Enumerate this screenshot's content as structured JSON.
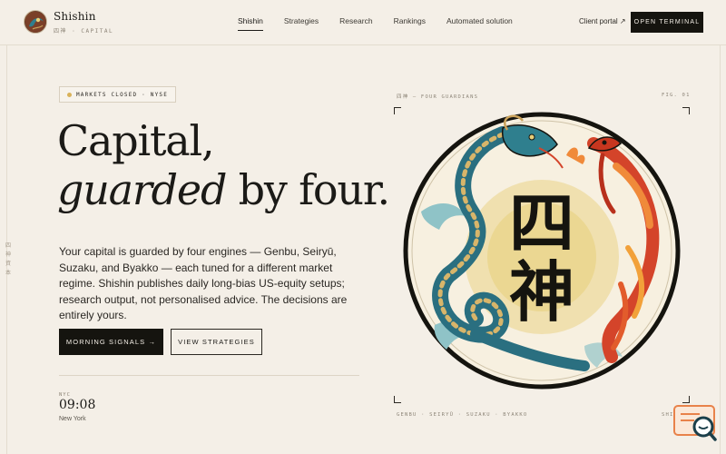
{
  "brand": {
    "name": "Shishin",
    "subtitle": "四神 · CAPITAL"
  },
  "nav": {
    "items": [
      {
        "label": "Shishin",
        "active": true
      },
      {
        "label": "Strategies",
        "active": false
      },
      {
        "label": "Research",
        "active": false
      },
      {
        "label": "Rankings",
        "active": false
      },
      {
        "label": "Automated solution",
        "active": false
      }
    ],
    "client_portal": "Client portal ↗",
    "open_terminal": "OPEN TERMINAL"
  },
  "side_label": "四神資本",
  "hero": {
    "status": "MARKETS CLOSED · NYSE",
    "headline_line1": "Capital,",
    "headline_line2_italic": "guarded",
    "headline_line2_rest": " by four.",
    "description": "Your capital is guarded by four engines — Genbu, Seiryū, Suzaku, and Byakko — each tuned for a different market regime. Shishin publishes daily long-bias US-equity setups; research output, not personalised advice. The decisions are entirely yours.",
    "primary_button": "MORNING SIGNALS →",
    "secondary_button": "VIEW STRATEGIES"
  },
  "clock": {
    "label": "NYC",
    "time": "09:08",
    "city": "New York"
  },
  "figure": {
    "caption": "四神 — FOUR GUARDIANS",
    "number": "FIG. 01",
    "emblem_text": "四神",
    "footer": "GENBU · SEIRYŪ · SUZAKU · BYAKKO",
    "code": "SHI-0"
  },
  "colors": {
    "background": "#f4efe7",
    "ink": "#15140f",
    "status_dot": "#d9b25a",
    "dragon_teal": "#2f7f8e",
    "phoenix_red": "#d4442a",
    "sun_gold": "#e8cf7a"
  },
  "icons": {
    "logo": "dragon-medallion-icon",
    "status": "status-dot-icon",
    "widget": "chat-search-icon"
  }
}
